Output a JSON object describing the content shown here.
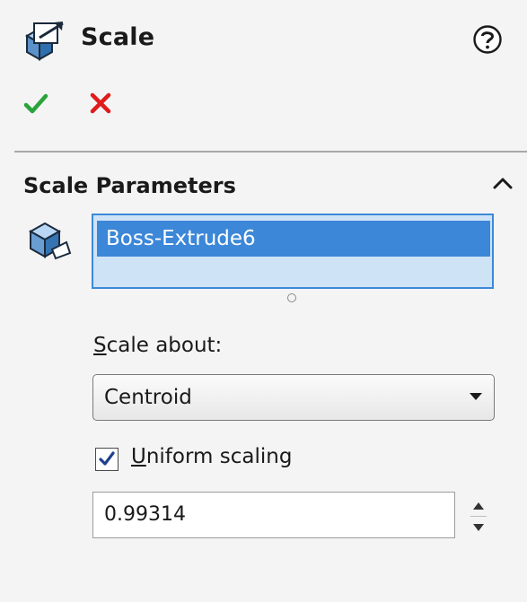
{
  "header": {
    "title": "Scale",
    "feature_icon": "scale-feature-icon",
    "help_icon": "help-question-icon",
    "ok_icon": "green-checkmark-icon",
    "cancel_icon": "red-x-icon"
  },
  "group": {
    "title": "Scale Parameters",
    "collapse_icon": "chevron-up-icon",
    "body_icon": "solid-body-icon",
    "selected_items": [
      "Boss-Extrude6"
    ]
  },
  "scale_about": {
    "label_hotkey": "S",
    "label_rest": "cale about:",
    "selected_value": "Centroid"
  },
  "uniform_scaling": {
    "checked": true,
    "label_hotkey": "U",
    "label_rest": "niform scaling"
  },
  "scale_factor": {
    "value": "0.99314"
  },
  "colors": {
    "selection_highlight": "#3c87d8",
    "selection_box_bg": "#cfe3f7",
    "ok_green": "#2aa33b",
    "cancel_red": "#e01b1b"
  }
}
